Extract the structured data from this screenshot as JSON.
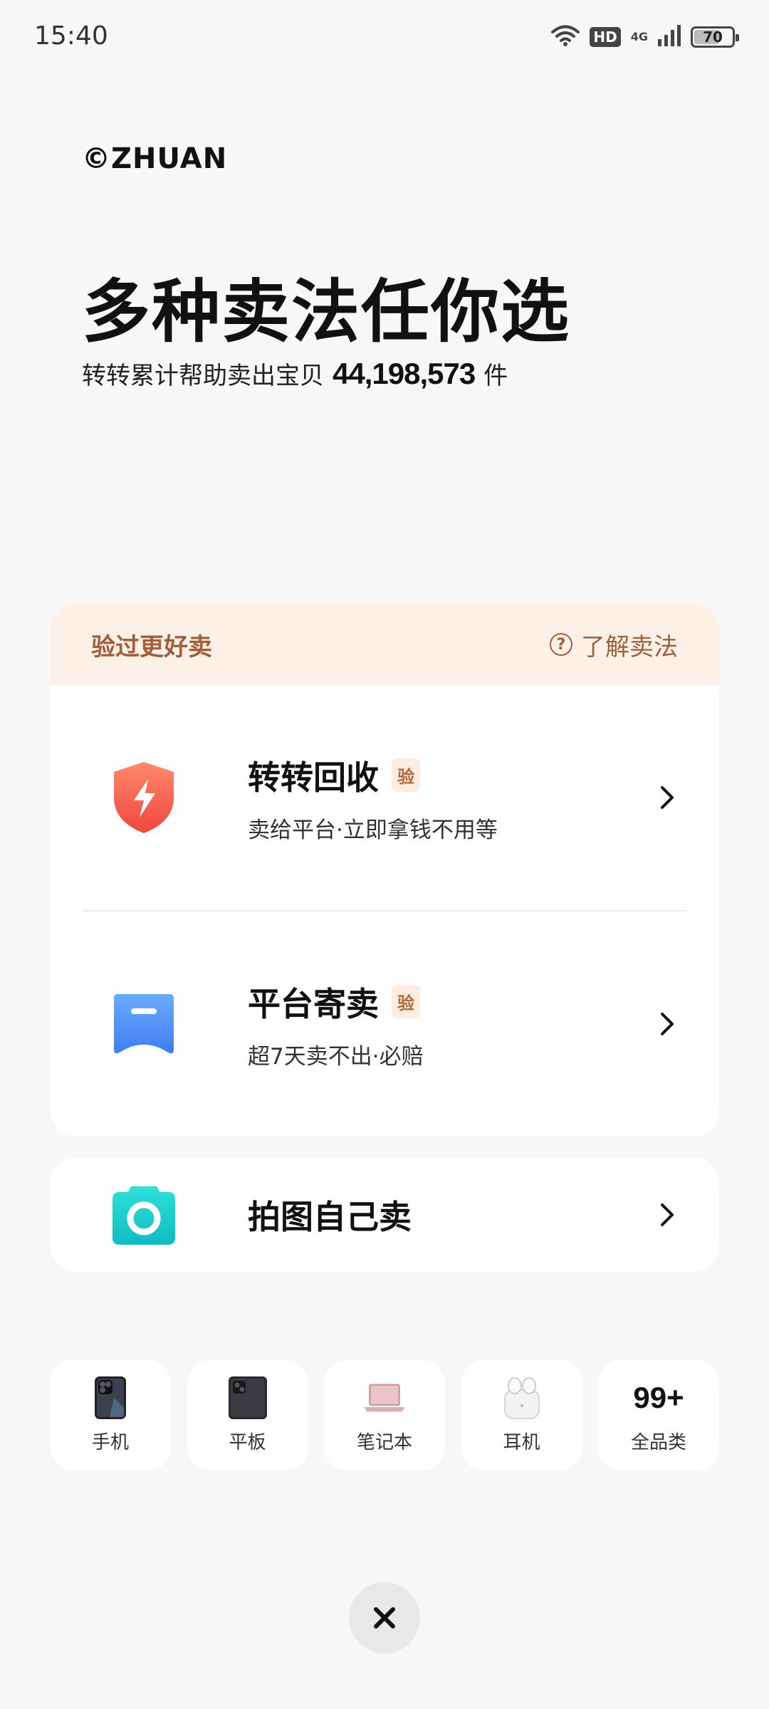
{
  "status_bar": {
    "time": "15:40",
    "hd_label": "HD",
    "network_label": "4G",
    "battery_level": 70,
    "battery_text": "70"
  },
  "brand": {
    "logo_text": "©ZHUAN"
  },
  "hero": {
    "headline": "多种卖法任你选",
    "subline_prefix": "转转累计帮助卖出宝贝",
    "sold_count": "44,198,573",
    "subline_suffix": "件"
  },
  "verified_section": {
    "title": "验过更好卖",
    "learn_more_label": "了解卖法",
    "options": [
      {
        "title": "转转回收",
        "badge": "验",
        "description": "卖给平台·立即拿钱不用等",
        "icon": "shield-bolt-icon"
      },
      {
        "title": "平台寄卖",
        "badge": "验",
        "description": "超7天卖不出·必赔",
        "icon": "tag-icon"
      }
    ]
  },
  "self_sell": {
    "title": "拍图自己卖",
    "icon": "camera-icon"
  },
  "categories": [
    {
      "label": "手机",
      "icon": "phone-icon"
    },
    {
      "label": "平板",
      "icon": "tablet-icon"
    },
    {
      "label": "笔记本",
      "icon": "laptop-icon"
    },
    {
      "label": "耳机",
      "icon": "earbuds-icon"
    },
    {
      "label": "全品类",
      "badge": "99+"
    }
  ],
  "colors": {
    "accent_brown": "#a0603c",
    "header_bg": "#fdf0e6",
    "recycle_red": "#f4564a",
    "consign_blue": "#4f8ff7",
    "camera_teal": "#16c6c6"
  }
}
